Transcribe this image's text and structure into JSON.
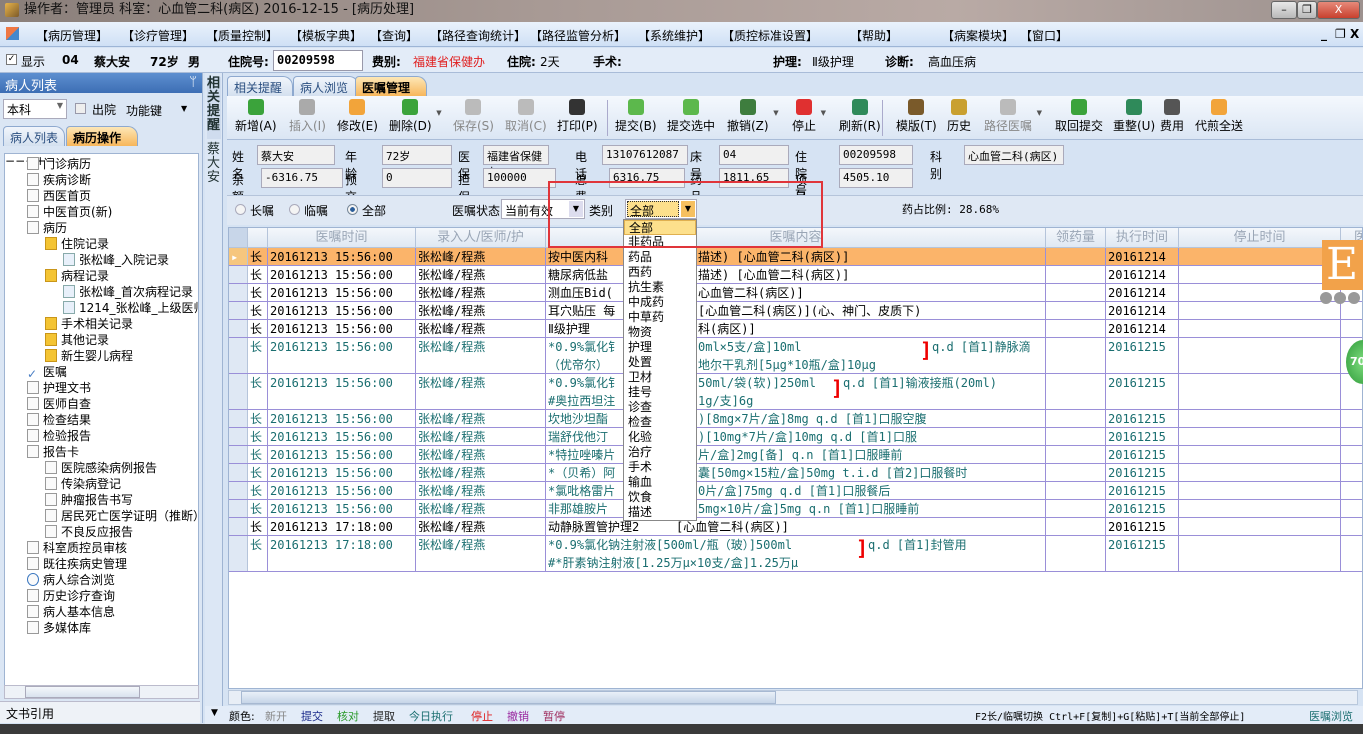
{
  "window": {
    "title": "操作者：管理员  科室：心血管二科(病区)  2016-12-15 - [病历处理]",
    "min": "–",
    "restore": "❐",
    "close": "X"
  },
  "menu": {
    "items": [
      "【病历管理】",
      "【诊疗管理】",
      "【质量控制】",
      "【模板字典】",
      "【查询】",
      "【路径查询统计】",
      "【路径监管分析】",
      "【系统维护】",
      "【质控标准设置】",
      "【帮助】",
      "【病案模块】",
      "【窗口】"
    ],
    "mdi_min": "_",
    "mdi_restore": "❐",
    "mdi_close": "X"
  },
  "patient_bar": {
    "show_label": "显示",
    "show_checked": true,
    "bed": "04",
    "name": "蔡大安",
    "age": "72岁",
    "sex": "男",
    "inpatient_no_label": "住院号:",
    "inpatient_no": "00209598",
    "fee_type_label": "费别:",
    "fee_type": "福建省保健办",
    "stay_label": "住院:",
    "stay": "2天",
    "surgery_label": "手术:",
    "nursing_label": "护理:",
    "nursing": "Ⅱ级护理",
    "diagnosis_label": "诊断:",
    "diagnosis": "高血压病"
  },
  "left_panel": {
    "title": "病人列表",
    "pin": "ᛘ",
    "dept_select": "本科",
    "discharged_label": "出院",
    "function_keys": "功能键",
    "tabs": [
      "病人列表",
      "病历操作"
    ],
    "active_tab": 1,
    "tree": [
      {
        "label": "门诊病历",
        "level": 0,
        "icon": "book-icon"
      },
      {
        "label": "疾病诊断",
        "level": 0,
        "icon": "calendar-icon"
      },
      {
        "label": "西医首页",
        "level": 0,
        "icon": "document-icon"
      },
      {
        "label": "中医首页(新)",
        "level": 0,
        "icon": "clipboard-icon"
      },
      {
        "label": "病历",
        "level": 0,
        "icon": "clipboard-icon",
        "expander": "−"
      },
      {
        "label": "住院记录",
        "level": 1,
        "icon": "folder-icon",
        "expander": "−"
      },
      {
        "label": "张松峰_入院记录",
        "level": 2,
        "icon": "file-icon"
      },
      {
        "label": "病程记录",
        "level": 1,
        "icon": "folder-icon",
        "expander": "−"
      },
      {
        "label": "张松峰_首次病程记录",
        "level": 2,
        "icon": "file-icon"
      },
      {
        "label": "1214_张松峰_上级医师",
        "level": 2,
        "icon": "file-icon"
      },
      {
        "label": "手术相关记录",
        "level": 1,
        "icon": "folder-icon"
      },
      {
        "label": "其他记录",
        "level": 1,
        "icon": "folder-icon"
      },
      {
        "label": "新生婴儿病程",
        "level": 1,
        "icon": "folder-icon"
      },
      {
        "label": "医嘱",
        "level": 0,
        "icon": "check-icon"
      },
      {
        "label": "护理文书",
        "level": 0,
        "icon": "clipboard-icon",
        "expander": "+"
      },
      {
        "label": "医师自查",
        "level": 0,
        "icon": "clipboard-icon"
      },
      {
        "label": "检查结果",
        "level": 0,
        "icon": "magnifier-doc-icon"
      },
      {
        "label": "检验报告",
        "level": 0,
        "icon": "pin-doc-icon"
      },
      {
        "label": "报告卡",
        "level": 0,
        "icon": "clipboard-icon",
        "expander": "−"
      },
      {
        "label": "医院感染病例报告",
        "level": 1,
        "icon": "clipboard-icon"
      },
      {
        "label": "传染病登记",
        "level": 1,
        "icon": "chart-doc-icon"
      },
      {
        "label": "肿瘤报告书写",
        "level": 1,
        "icon": "clipboard-icon"
      },
      {
        "label": "居民死亡医学证明（推断）",
        "level": 1,
        "icon": "clipboard-icon"
      },
      {
        "label": "不良反应报告",
        "level": 1,
        "icon": "clipboard-icon"
      },
      {
        "label": "科室质控员审核",
        "level": 0,
        "icon": "clipboard-icon"
      },
      {
        "label": "既往疾病史管理",
        "level": 0,
        "icon": "clipboard-icon"
      },
      {
        "label": "病人综合浏览",
        "level": 0,
        "icon": "search-icon"
      },
      {
        "label": "历史诊疗查询",
        "level": 0,
        "icon": "clipboard-icon"
      },
      {
        "label": "病人基本信息",
        "level": 0,
        "icon": "clipboard-icon"
      },
      {
        "label": "多媒体库",
        "level": 0,
        "icon": "clipboard-icon"
      }
    ],
    "footer": "文书引用"
  },
  "side_tabs": {
    "reminder": "相关提醒",
    "patient": "蔡大安"
  },
  "main_tabs": [
    "相关提醒",
    "病人浏览",
    "医嘱管理"
  ],
  "main_active_tab": 2,
  "toolbar": [
    {
      "label": "新增(A)",
      "icon": "add-icon",
      "color": "#3ba33b"
    },
    {
      "label": "插入(I)",
      "icon": "insert-icon",
      "color": "#aaa",
      "disabled": true
    },
    {
      "label": "修改(E)",
      "icon": "edit-icon",
      "color": "#f2a43a"
    },
    {
      "label": "删除(D)",
      "icon": "delete-icon",
      "color": "#3ba33b",
      "dropdown": true
    },
    {
      "label": "保存(S)",
      "icon": "save-icon",
      "color": "#bbb",
      "disabled": true
    },
    {
      "label": "取消(C)",
      "icon": "undo-icon",
      "color": "#bbb",
      "disabled": true
    },
    {
      "label": "打印(P)",
      "icon": "print-icon",
      "color": "#333"
    },
    {
      "label": "提交(B)",
      "icon": "submit-icon",
      "color": "#5cb84c"
    },
    {
      "label": "提交选中",
      "icon": "submit-selected-icon",
      "color": "#5cb84c"
    },
    {
      "label": "撤销(Z)",
      "icon": "trash-icon",
      "color": "#3e7d3e",
      "dropdown": true
    },
    {
      "label": "停止",
      "icon": "stop-icon",
      "color": "#e03030",
      "dropdown": true
    },
    {
      "label": "刷新(R)",
      "icon": "refresh-icon",
      "color": "#2f8a5a"
    },
    {
      "label": "模版(T)",
      "icon": "template-icon",
      "color": "#7a5a2a"
    },
    {
      "label": "历史",
      "icon": "history-icon",
      "color": "#c9a030"
    },
    {
      "label": "路径医嘱",
      "icon": "path-order-icon",
      "color": "#bbb",
      "disabled": true,
      "dropdown": true
    },
    {
      "label": "取回提交",
      "icon": "retrieve-icon",
      "color": "#3ba33b"
    },
    {
      "label": "重整(U)",
      "icon": "reorganize-icon",
      "color": "#2f8a5a"
    },
    {
      "label": "费用",
      "icon": "calculator-icon",
      "color": "#555"
    },
    {
      "label": "代煎全送",
      "icon": "eraser-icon",
      "color": "#f2a43a"
    }
  ],
  "form": {
    "name_label": "姓名",
    "name": "蔡大安",
    "age_label": "年龄",
    "age": "72岁",
    "insurance_label": "医保",
    "insurance": "福建省保健办",
    "phone_label": "电话",
    "phone": "13107612087",
    "bed_label": "床号",
    "bed": "04",
    "inpatient_no_label": "住院号",
    "inpatient_no": "00209598",
    "dept_label": "科别",
    "dept": "心血管二科(病区)",
    "balance_label": "余额",
    "balance": "-6316.75",
    "prepay_label": "预交金",
    "prepay": "0",
    "guarantee_label": "担保",
    "guarantee": "100000",
    "total_label": "总费用",
    "total": "6316.75",
    "drug_label": "药品",
    "drug": "1811.65",
    "item_label": "项目",
    "item": "4505.10"
  },
  "filters": {
    "long_term": "长嘱",
    "temporary": "临嘱",
    "all": "全部",
    "selected": "全部",
    "status_label": "医嘱状态",
    "status_value": "当前有效",
    "category_label": "类别",
    "category_value": "全部",
    "drug_ratio": "药占比例: 28.68%"
  },
  "category_options": [
    "全部",
    "非药品",
    "药品",
    "西药",
    "抗生素",
    "中成药",
    "中草药",
    "物资",
    "护理",
    "处置",
    "卫材",
    "挂号",
    "诊查",
    "检查",
    "化验",
    "治疗",
    "手术",
    "输血",
    "饮食",
    "描述"
  ],
  "grid": {
    "columns": [
      "医嘱时间",
      "录入人/医师/护",
      "医嘱内容",
      "领药量",
      "执行时间",
      "停止时间",
      "医"
    ],
    "rows": [
      {
        "type": "长",
        "time": "20161213 15:56:00",
        "by": "张松峰/程燕",
        "c1l": "按中医内科",
        "c1r": "描述)  [心血管二科(病区)]",
        "exec": "20161214",
        "style": "black",
        "selected": true
      },
      {
        "type": "长",
        "time": "20161213 15:56:00",
        "by": "张松峰/程燕",
        "c1l": "糖尿病低盐",
        "c1r": "描述)  [心血管二科(病区)]",
        "exec": "20161214",
        "style": "black"
      },
      {
        "type": "长",
        "time": "20161213 15:56:00",
        "by": "张松峰/程燕",
        "c1l": "测血压Bid(",
        "c1r": "心血管二科(病区)]",
        "exec": "20161214",
        "style": "black"
      },
      {
        "type": "长",
        "time": "20161213 15:56:00",
        "by": "张松峰/程燕",
        "c1l": "耳穴贴压 每",
        "c1r": "[心血管二科(病区)](心、神门、皮质下)",
        "exec": "20161214",
        "style": "black"
      },
      {
        "type": "长",
        "time": "20161213 15:56:00",
        "by": "张松峰/程燕",
        "c1l": "Ⅱ级护理",
        "c1r": "科(病区)]",
        "exec": "20161214",
        "style": "black"
      },
      {
        "type": "长",
        "time": "20161213 15:56:00",
        "by": "张松峰/程燕",
        "c1l": "*0.9%氯化钅",
        "c1r": "0ml×5支/盒]10ml",
        "c2l": "（优帝尔）",
        "c2r": "地尔干乳剂[5μg*10瓶/盒]10μg",
        "tail": "q.d  [首1]静脉滴",
        "exec": "20161215",
        "style": "teal",
        "group": true
      },
      {
        "type": "长",
        "time": "20161213 15:56:00",
        "by": "张松峰/程燕",
        "c1l": "*0.9%氯化钅",
        "c1r": "50ml/袋(软)]250ml",
        "c2l": "#奥拉西坦注",
        "c2r": "1g/支]6g",
        "tail": "q.d  [首1]输液接瓶(20ml)",
        "exec": "20161215",
        "style": "teal",
        "group": true
      },
      {
        "type": "长",
        "time": "20161213 15:56:00",
        "by": "张松峰/程燕",
        "c1l": "坎地沙坦酯",
        "c1r": ")[8mg×7片/盒]8mg q.d  [首1]口服空腹",
        "exec": "20161215",
        "style": "teal"
      },
      {
        "type": "长",
        "time": "20161213 15:56:00",
        "by": "张松峰/程燕",
        "c1l": "瑞舒伐他汀",
        "c1r": ")[10mg*7片/盒]10mg q.d  [首1]口服",
        "exec": "20161215",
        "style": "teal"
      },
      {
        "type": "长",
        "time": "20161213 15:56:00",
        "by": "张松峰/程燕",
        "c1l": "*特拉唑嗪片",
        "c1r": "片/盒]2mg[备] q.n  [首1]口服睡前",
        "exec": "20161215",
        "style": "teal"
      },
      {
        "type": "长",
        "time": "20161213 15:56:00",
        "by": "张松峰/程燕",
        "c1l": "*（贝希）阿",
        "c1r": "囊[50mg×15粒/盒]50mg t.i.d  [首2]口服餐时",
        "exec": "20161215",
        "style": "teal"
      },
      {
        "type": "长",
        "time": "20161213 15:56:00",
        "by": "张松峰/程燕",
        "c1l": "*氯吡格雷片",
        "c1r": "0片/盒]75mg q.d  [首1]口服餐后",
        "exec": "20161215",
        "style": "teal"
      },
      {
        "type": "长",
        "time": "20161213 15:56:00",
        "by": "张松峰/程燕",
        "c1l": "非那雄胺片",
        "c1r": "5mg×10片/盒]5mg q.n  [首1]口服睡前",
        "exec": "20161215",
        "style": "teal"
      },
      {
        "type": "长",
        "time": "20161213 17:18:00",
        "by": "张松峰/程燕",
        "c1l": "动静脉置管护理2",
        "c1r": "[心血管二科(病区)]",
        "exec": "20161215",
        "style": "black"
      },
      {
        "type": "长",
        "time": "20161213 17:18:00",
        "by": "张松峰/程燕",
        "c1l": "*0.9%氯化钠注射液[500ml/瓶（玻）]500ml",
        "c1r": "",
        "c2l": "#*肝素钠注射液[1.25万μ×10支/盒]1.25万μ",
        "c2r": "",
        "tail": "q.d  [首1]封管用",
        "exec": "20161215",
        "style": "teal",
        "group": true,
        "full": true
      }
    ]
  },
  "status": {
    "legend_label": "颜色:",
    "legend": [
      {
        "t": "新开",
        "c": "#888888"
      },
      {
        "t": "提交",
        "c": "#1a2a8a"
      },
      {
        "t": "核对",
        "c": "#2a9a2a"
      },
      {
        "t": "提取",
        "c": "#222222"
      },
      {
        "t": "今日执行",
        "c": "#1a6e70"
      },
      {
        "t": "停止",
        "c": "#e02020"
      },
      {
        "t": "撤销",
        "c": "#9a2aa0"
      },
      {
        "t": "暂停",
        "c": "#a03060"
      }
    ],
    "shortcuts": "F2长/临嘱切换 Ctrl+F[复制]+G[粘贴]+T[当前全部停止]",
    "right_link": "医嘱浏览"
  },
  "floating": {
    "badge": "E",
    "circle": "70"
  }
}
